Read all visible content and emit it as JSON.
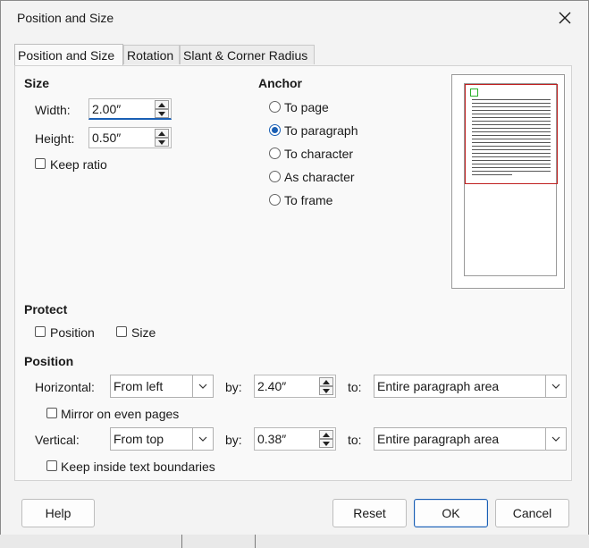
{
  "window": {
    "title": "Position and Size"
  },
  "tabs": [
    {
      "label": "Position and Size",
      "active": true
    },
    {
      "label": "Rotation",
      "active": false
    },
    {
      "label": "Slant & Corner Radius",
      "active": false
    }
  ],
  "size": {
    "title": "Size",
    "width_label": "Width:",
    "width_value": "2.00″",
    "height_label": "Height:",
    "height_value": "0.50″",
    "keep_ratio_label": "Keep ratio",
    "keep_ratio_checked": false
  },
  "anchor": {
    "title": "Anchor",
    "options": [
      {
        "label": "To page",
        "checked": false
      },
      {
        "label": "To paragraph",
        "checked": true
      },
      {
        "label": "To character",
        "checked": false
      },
      {
        "label": "As character",
        "checked": false
      },
      {
        "label": "To frame",
        "checked": false
      }
    ]
  },
  "protect": {
    "title": "Protect",
    "position_label": "Position",
    "size_label": "Size"
  },
  "position": {
    "title": "Position",
    "horizontal_label": "Horizontal:",
    "horizontal_value": "From left",
    "horizontal_by_label": "by:",
    "horizontal_by_value": "2.40″",
    "horizontal_to_label": "to:",
    "horizontal_to_value": "Entire paragraph area",
    "mirror_label": "Mirror on even pages",
    "vertical_label": "Vertical:",
    "vertical_value": "From top",
    "vertical_by_label": "by:",
    "vertical_by_value": "0.38″",
    "vertical_to_label": "to:",
    "vertical_to_value": "Entire paragraph area",
    "keep_inside_label": "Keep inside text boundaries"
  },
  "buttons": {
    "help": "Help",
    "reset": "Reset",
    "ok": "OK",
    "cancel": "Cancel"
  },
  "colors": {
    "accent": "#1a5fb4",
    "preview_paragraph": "#c02020",
    "preview_object": "#2bb12b"
  }
}
